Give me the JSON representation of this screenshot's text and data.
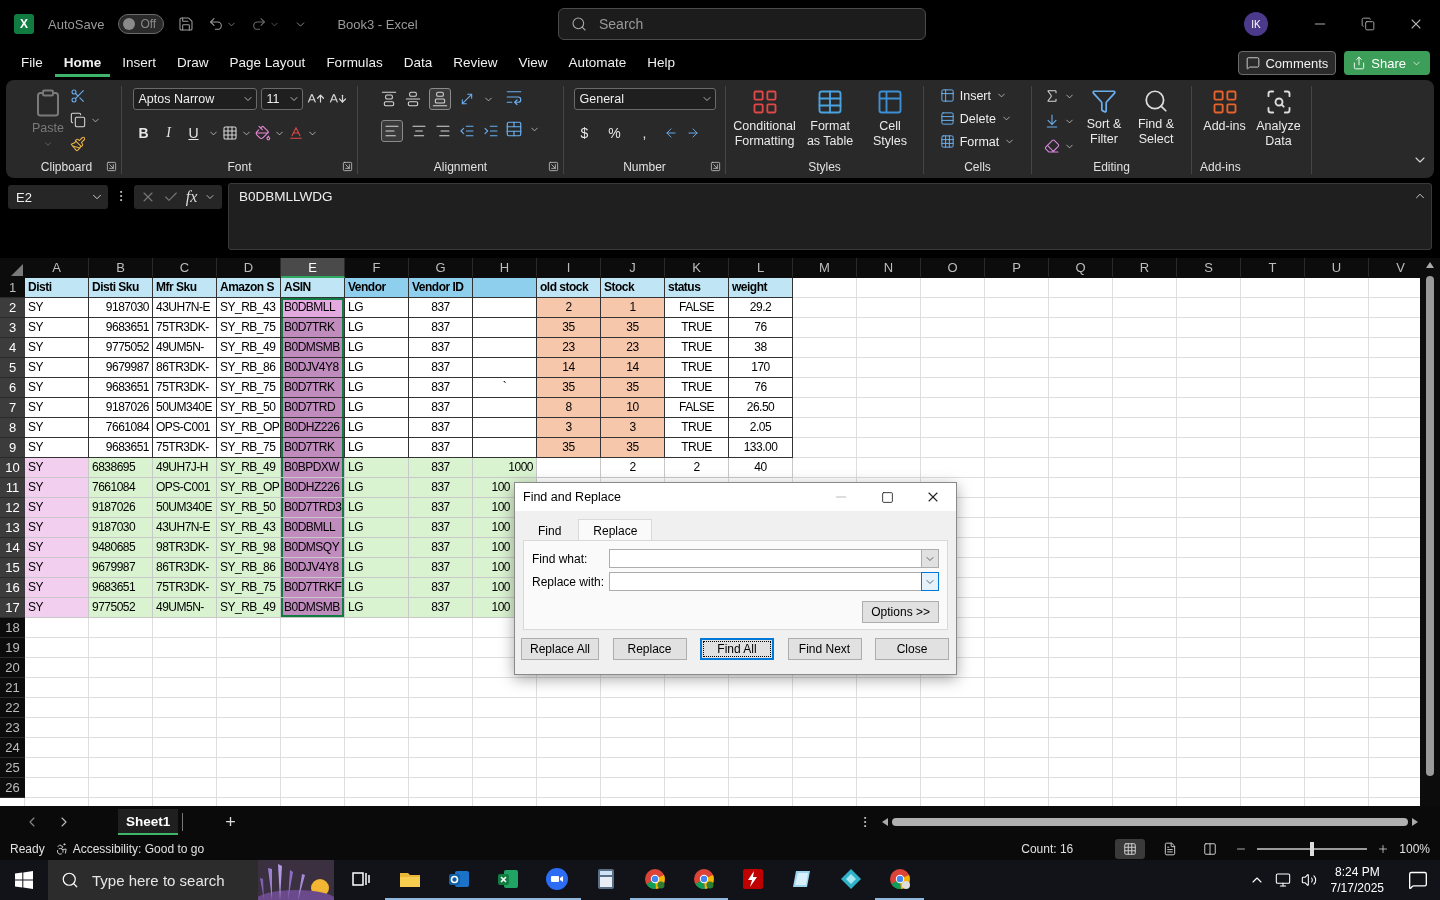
{
  "title_bar": {
    "logo": "X",
    "autosave": {
      "label": "AutoSave",
      "state": "Off",
      "on": false
    },
    "document_title": "Book3  -  Excel",
    "search": {
      "placeholder": "Search"
    },
    "avatar": "IK"
  },
  "menu": {
    "tabs": [
      {
        "label": "File",
        "selected": false
      },
      {
        "label": "Home",
        "selected": true
      },
      {
        "label": "Insert",
        "selected": false
      },
      {
        "label": "Draw",
        "selected": false
      },
      {
        "label": "Page Layout",
        "selected": false
      },
      {
        "label": "Formulas",
        "selected": false
      },
      {
        "label": "Data",
        "selected": false
      },
      {
        "label": "Review",
        "selected": false
      },
      {
        "label": "View",
        "selected": false
      },
      {
        "label": "Automate",
        "selected": false
      },
      {
        "label": "Help",
        "selected": false
      }
    ],
    "comments": "Comments",
    "share": "Share"
  },
  "ribbon": {
    "clipboard": {
      "label": "Clipboard",
      "paste": "Paste",
      "paste_disabled": true
    },
    "font": {
      "label": "Font",
      "family": "Aptos Narrow",
      "size": "11",
      "styles": [
        "B",
        "I",
        "U"
      ]
    },
    "alignment": {
      "label": "Alignment"
    },
    "number": {
      "label": "Number",
      "format": "General",
      "symbols": [
        "$",
        "%",
        ","
      ]
    },
    "styles": {
      "label": "Styles",
      "buttons": [
        "Conditional Formatting",
        "Format as Table",
        "Cell Styles"
      ]
    },
    "cells": {
      "label": "Cells",
      "buttons": [
        "Insert",
        "Delete",
        "Format"
      ]
    },
    "editing": {
      "label": "Editing",
      "buttons": [
        "Sort & Filter",
        "Find & Select"
      ]
    },
    "addins": {
      "label": "Add-ins",
      "buttons": [
        "Add-ins",
        "Analyze Data"
      ]
    }
  },
  "formula_bar": {
    "name_box": "E2",
    "function_label": "fx",
    "value": "B0DBMLLWDG"
  },
  "sheet": {
    "columns": [
      {
        "label": "A",
        "selected": false
      },
      {
        "label": "B",
        "selected": false
      },
      {
        "label": "C",
        "selected": false
      },
      {
        "label": "D",
        "selected": false
      },
      {
        "label": "E",
        "selected": true
      },
      {
        "label": "F",
        "selected": false
      },
      {
        "label": "G",
        "selected": false
      },
      {
        "label": "H",
        "selected": false
      },
      {
        "label": "I",
        "selected": false
      },
      {
        "label": "J",
        "selected": false
      },
      {
        "label": "K",
        "selected": false
      },
      {
        "label": "L",
        "selected": false
      },
      {
        "label": "M",
        "selected": false
      },
      {
        "label": "N",
        "selected": false
      },
      {
        "label": "O",
        "selected": false
      },
      {
        "label": "P",
        "selected": false
      },
      {
        "label": "Q",
        "selected": false
      },
      {
        "label": "R",
        "selected": false
      },
      {
        "label": "S",
        "selected": false
      },
      {
        "label": "T",
        "selected": false
      },
      {
        "label": "U",
        "selected": false
      },
      {
        "label": "V",
        "selected": false
      }
    ],
    "rows": [
      {
        "number": "1",
        "selected": false,
        "kind": "header",
        "cells": [
          {
            "text": "Disti",
            "color": "#c0e6f5"
          },
          {
            "text": "Disti Sku",
            "color": "#c0e6f5"
          },
          {
            "text": "Mfr Sku",
            "color": "#c0e6f5"
          },
          {
            "text": "Amazon S",
            "color": "#c0e6f5"
          },
          {
            "text": "ASIN",
            "color": "#c0e6f5"
          },
          {
            "text": "Vendor",
            "color": "#8fcfee"
          },
          {
            "text": "Vendor ID",
            "color": "#8fcfee"
          },
          {
            "color": "#8fcfee"
          },
          {
            "text": "old stock",
            "color": "#c0e6f5"
          },
          {
            "text": "Stock",
            "color": "#c0e6f5"
          },
          {
            "text": "status",
            "color": "#c0e6f5"
          },
          {
            "text": "weight",
            "color": "#c0e6f5"
          }
        ]
      },
      {
        "number": "2",
        "selected": true,
        "kind": "boxed",
        "cells": [
          {
            "text": "SY"
          },
          {
            "text": "9187030"
          },
          {
            "text": "43UH7N-E"
          },
          {
            "text": "SY_RB_43"
          },
          {
            "text": "B0DBMLL",
            "color": "#e3a9e0"
          },
          {
            "text": "LG"
          },
          {
            "text": "837"
          },
          {},
          {
            "text": "2",
            "color": "#f7c7ac"
          },
          {
            "text": "1",
            "color": "#f7c7ac"
          },
          {
            "text": "FALSE"
          },
          {
            "text": "29.2"
          }
        ]
      },
      {
        "number": "3",
        "selected": true,
        "kind": "boxed",
        "cells": [
          {
            "text": "SY"
          },
          {
            "text": "9683651"
          },
          {
            "text": "75TR3DK-"
          },
          {
            "text": "SY_RB_75"
          },
          {
            "text": "B0D7TRK",
            "color": "#bf8cbd"
          },
          {
            "text": "LG"
          },
          {
            "text": "837"
          },
          {},
          {
            "text": "35",
            "color": "#f7c7ac"
          },
          {
            "text": "35",
            "color": "#f7c7ac"
          },
          {
            "text": "TRUE"
          },
          {
            "text": "76"
          }
        ]
      },
      {
        "number": "4",
        "selected": true,
        "kind": "boxed",
        "cells": [
          {
            "text": "SY"
          },
          {
            "text": "9775052"
          },
          {
            "text": "49UM5N-"
          },
          {
            "text": "SY_RB_49"
          },
          {
            "text": "B0DMSMB",
            "color": "#bf8cbd"
          },
          {
            "text": "LG"
          },
          {
            "text": "837"
          },
          {},
          {
            "text": "23",
            "color": "#f7c7ac"
          },
          {
            "text": "23",
            "color": "#f7c7ac"
          },
          {
            "text": "TRUE"
          },
          {
            "text": "38"
          }
        ]
      },
      {
        "number": "5",
        "selected": true,
        "kind": "boxed",
        "cells": [
          {
            "text": "SY"
          },
          {
            "text": "9679987"
          },
          {
            "text": "86TR3DK-"
          },
          {
            "text": "SY_RB_86"
          },
          {
            "text": "B0DJV4Y8",
            "color": "#bf8cbd"
          },
          {
            "text": "LG"
          },
          {
            "text": "837"
          },
          {},
          {
            "text": "14",
            "color": "#f7c7ac"
          },
          {
            "text": "14",
            "color": "#f7c7ac"
          },
          {
            "text": "TRUE"
          },
          {
            "text": "170"
          }
        ]
      },
      {
        "number": "6",
        "selected": true,
        "kind": "boxed",
        "cells": [
          {
            "text": "SY"
          },
          {
            "text": "9683651"
          },
          {
            "text": "75TR3DK-"
          },
          {
            "text": "SY_RB_75"
          },
          {
            "text": "B0D7TRK",
            "color": "#bf8cbd"
          },
          {
            "text": "LG"
          },
          {
            "text": "837"
          },
          {
            "text": "`"
          },
          {
            "text": "35",
            "color": "#f7c7ac"
          },
          {
            "text": "35",
            "color": "#f7c7ac"
          },
          {
            "text": "TRUE"
          },
          {
            "text": "76"
          }
        ]
      },
      {
        "number": "7",
        "selected": true,
        "kind": "boxed",
        "cells": [
          {
            "text": "SY"
          },
          {
            "text": "9187026"
          },
          {
            "text": "50UM340E"
          },
          {
            "text": "SY_RB_50"
          },
          {
            "text": "B0D7TRD",
            "color": "#bf8cbd"
          },
          {
            "text": "LG"
          },
          {
            "text": "837"
          },
          {},
          {
            "text": "8",
            "color": "#f7c7ac"
          },
          {
            "text": "10",
            "color": "#f7c7ac"
          },
          {
            "text": "FALSE"
          },
          {
            "text": "26.50"
          }
        ]
      },
      {
        "number": "8",
        "selected": true,
        "kind": "boxed",
        "cells": [
          {
            "text": "SY"
          },
          {
            "text": "7661084"
          },
          {
            "text": "OPS-C001"
          },
          {
            "text": "SY_RB_OP"
          },
          {
            "text": "B0DHZ226",
            "color": "#bf8cbd"
          },
          {
            "text": "LG"
          },
          {
            "text": "837"
          },
          {},
          {
            "text": "3",
            "color": "#f7c7ac"
          },
          {
            "text": "3",
            "color": "#f7c7ac"
          },
          {
            "text": "TRUE"
          },
          {
            "text": "2.05"
          }
        ]
      },
      {
        "number": "9",
        "selected": true,
        "kind": "boxed",
        "cells": [
          {
            "text": "SY"
          },
          {
            "text": "9683651"
          },
          {
            "text": "75TR3DK-"
          },
          {
            "text": "SY_RB_75"
          },
          {
            "text": "B0D7TRK",
            "color": "#bf8cbd"
          },
          {
            "text": "LG"
          },
          {
            "text": "837"
          },
          {},
          {
            "text": "35",
            "color": "#f7c7ac"
          },
          {
            "text": "35",
            "color": "#f7c7ac"
          },
          {
            "text": "TRUE"
          },
          {
            "text": "133.00"
          }
        ]
      },
      {
        "number": "10",
        "selected": true,
        "kind": "grid",
        "cells": [
          {
            "text": "SY",
            "color": "#f2ceef"
          },
          {
            "text": "6838695",
            "color": "#d9f2d0"
          },
          {
            "text": "49UH7J-H",
            "color": "#d9f2d0"
          },
          {
            "text": "SY_RB_49",
            "color": "#d9f2d0"
          },
          {
            "text": "B0BPDXW",
            "color": "#bf8cbd"
          },
          {
            "text": "LG",
            "color": "#d9f2d0"
          },
          {
            "text": "837",
            "color": "#d9f2d0"
          },
          {
            "text": "1000",
            "color": "#d9f2d0"
          },
          {},
          {
            "text": "2"
          },
          {
            "text": "2"
          },
          {
            "text": "40"
          }
        ]
      },
      {
        "number": "11",
        "selected": true,
        "kind": "covered",
        "cells": [
          {
            "text": "SY",
            "color": "#f2ceef"
          },
          {
            "text": "7661084",
            "color": "#d9f2d0"
          },
          {
            "text": "OPS-C001",
            "color": "#d9f2d0"
          },
          {
            "text": "SY_RB_OP",
            "color": "#d9f2d0"
          },
          {
            "text": "B0DHZ226",
            "color": "#bf8cbd"
          },
          {
            "text": "LG",
            "color": "#d9f2d0"
          },
          {
            "text": "837",
            "color": "#d9f2d0"
          },
          {
            "text": "100",
            "color": "#d9f2d0"
          }
        ]
      },
      {
        "number": "12",
        "selected": true,
        "kind": "covered",
        "cells": [
          {
            "text": "SY",
            "color": "#f2ceef"
          },
          {
            "text": "9187026",
            "color": "#d9f2d0"
          },
          {
            "text": "50UM340E",
            "color": "#d9f2d0"
          },
          {
            "text": "SY_RB_50",
            "color": "#d9f2d0"
          },
          {
            "text": "B0D7TRD3",
            "color": "#bf8cbd"
          },
          {
            "text": "LG",
            "color": "#d9f2d0"
          },
          {
            "text": "837",
            "color": "#d9f2d0"
          },
          {
            "text": "100",
            "color": "#d9f2d0"
          }
        ]
      },
      {
        "number": "13",
        "selected": true,
        "kind": "covered",
        "cells": [
          {
            "text": "SY",
            "color": "#f2ceef"
          },
          {
            "text": "9187030",
            "color": "#d9f2d0"
          },
          {
            "text": "43UH7N-E",
            "color": "#d9f2d0"
          },
          {
            "text": "SY_RB_43",
            "color": "#d9f2d0"
          },
          {
            "text": "B0DBMLL",
            "color": "#bf8cbd"
          },
          {
            "text": "LG",
            "color": "#d9f2d0"
          },
          {
            "text": "837",
            "color": "#d9f2d0"
          },
          {
            "text": "100",
            "color": "#d9f2d0"
          }
        ]
      },
      {
        "number": "14",
        "selected": true,
        "kind": "covered",
        "cells": [
          {
            "text": "SY",
            "color": "#f2ceef"
          },
          {
            "text": "9480685",
            "color": "#d9f2d0"
          },
          {
            "text": "98TR3DK-",
            "color": "#d9f2d0"
          },
          {
            "text": "SY_RB_98",
            "color": "#d9f2d0"
          },
          {
            "text": "B0DMSQY",
            "color": "#bf8cbd"
          },
          {
            "text": "LG",
            "color": "#d9f2d0"
          },
          {
            "text": "837",
            "color": "#d9f2d0"
          },
          {
            "text": "100",
            "color": "#d9f2d0"
          }
        ]
      },
      {
        "number": "15",
        "selected": true,
        "kind": "covered",
        "cells": [
          {
            "text": "SY",
            "color": "#f2ceef"
          },
          {
            "text": "9679987",
            "color": "#d9f2d0"
          },
          {
            "text": "86TR3DK-",
            "color": "#d9f2d0"
          },
          {
            "text": "SY_RB_86",
            "color": "#d9f2d0"
          },
          {
            "text": "B0DJV4Y8",
            "color": "#bf8cbd"
          },
          {
            "text": "LG",
            "color": "#d9f2d0"
          },
          {
            "text": "837",
            "color": "#d9f2d0"
          },
          {
            "text": "100",
            "color": "#d9f2d0"
          }
        ]
      },
      {
        "number": "16",
        "selected": true,
        "kind": "covered",
        "cells": [
          {
            "text": "SY",
            "color": "#f2ceef"
          },
          {
            "text": "9683651",
            "color": "#d9f2d0"
          },
          {
            "text": "75TR3DK-",
            "color": "#d9f2d0"
          },
          {
            "text": "SY_RB_75",
            "color": "#d9f2d0"
          },
          {
            "text": "B0D7TRKF",
            "color": "#bf8cbd"
          },
          {
            "text": "LG",
            "color": "#d9f2d0"
          },
          {
            "text": "837",
            "color": "#d9f2d0"
          },
          {
            "text": "100",
            "color": "#d9f2d0"
          }
        ]
      },
      {
        "number": "17",
        "selected": true,
        "kind": "covered",
        "cells": [
          {
            "text": "SY",
            "color": "#f2ceef"
          },
          {
            "text": "9775052",
            "color": "#d9f2d0"
          },
          {
            "text": "49UM5N-",
            "color": "#d9f2d0"
          },
          {
            "text": "SY_RB_49",
            "color": "#d9f2d0"
          },
          {
            "text": "B0DMSMB",
            "color": "#bf8cbd"
          },
          {
            "text": "LG",
            "color": "#d9f2d0"
          },
          {
            "text": "837",
            "color": "#d9f2d0"
          },
          {
            "text": "100",
            "color": "#d9f2d0"
          }
        ]
      },
      {
        "number": "18",
        "selected": false
      },
      {
        "number": "19",
        "selected": false
      },
      {
        "number": "20",
        "selected": false
      },
      {
        "number": "21",
        "selected": false
      },
      {
        "number": "22",
        "selected": false
      },
      {
        "number": "23",
        "selected": false
      },
      {
        "number": "24",
        "selected": false
      },
      {
        "number": "25",
        "selected": false
      },
      {
        "number": "26",
        "selected": false
      }
    ]
  },
  "dialog": {
    "title": "Find and Replace",
    "tabs": [
      {
        "label": "Find",
        "selected": false
      },
      {
        "label": "Replace",
        "selected": true
      }
    ],
    "fields": [
      {
        "label": "Find what:",
        "dropdown_highlighted": false
      },
      {
        "label": "Replace with:",
        "dropdown_highlighted": true
      }
    ],
    "options": "Options >>",
    "buttons": [
      {
        "label": "Replace All",
        "focused": false
      },
      {
        "label": "Replace",
        "focused": false
      },
      {
        "label": "Find All",
        "focused": true
      },
      {
        "label": "Find Next",
        "focused": false
      },
      {
        "label": "Close",
        "focused": false
      }
    ]
  },
  "sheet_tabs": {
    "tabs": [
      {
        "label": "Sheet1",
        "selected": true
      }
    ],
    "add": "+"
  },
  "status_bar": {
    "mode": "Ready",
    "accessibility": "Accessibility: Good to go",
    "count": "Count: 16",
    "views": [
      {
        "kind": "normal",
        "selected": true
      },
      {
        "kind": "page_layout",
        "selected": false
      },
      {
        "kind": "page_break",
        "selected": false
      }
    ],
    "zoom": {
      "level": 0.5,
      "reading": "100%"
    }
  },
  "taskbar": {
    "search": {
      "placeholder": "Type here to search"
    },
    "apps": [
      {
        "kind": "explorer",
        "running": true
      },
      {
        "kind": "mail",
        "running": true
      },
      {
        "kind": "sheet",
        "running": true
      },
      {
        "kind": "video",
        "running": true
      },
      {
        "kind": "calculator",
        "running": false
      },
      {
        "kind": "browser",
        "running": true
      },
      {
        "kind": "browser",
        "running": true
      },
      {
        "kind": "ftp",
        "running": false
      },
      {
        "kind": "glass",
        "running": false
      },
      {
        "kind": "diamond",
        "running": false
      },
      {
        "kind": "browser",
        "running": true
      }
    ],
    "time": "8:24 PM",
    "date": "7/17/2025"
  }
}
